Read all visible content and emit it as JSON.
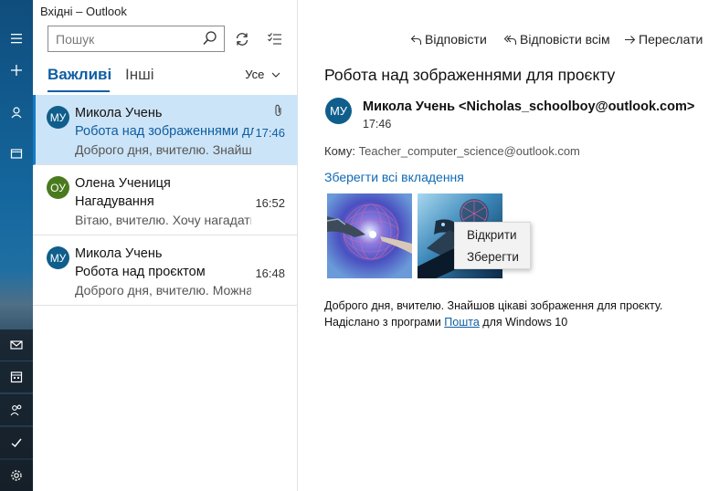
{
  "window": {
    "title": "Вхідні – Outlook"
  },
  "search": {
    "placeholder": "Пошук"
  },
  "tabs": [
    {
      "label": "Важливі"
    },
    {
      "label": "Інші"
    }
  ],
  "filter": {
    "label": "Усе"
  },
  "messages": [
    {
      "initials": "МУ",
      "avatar_color": "#0f5e8c",
      "sender": "Микола Учень",
      "subject": "Робота над зображеннями для проєкту",
      "preview": "Доброго дня, вчителю. Знайшов цікаві",
      "time": "17:46",
      "selected": true,
      "has_attachment": true
    },
    {
      "initials": "ОУ",
      "avatar_color": "#4a7a1e",
      "sender": "Олена Учениця",
      "subject": "Нагадування",
      "preview": "Вітаю, вчителю. Хочу нагадати",
      "time": "16:52",
      "selected": false
    },
    {
      "initials": "МУ",
      "avatar_color": "#0f5e8c",
      "sender": "Микола Учень",
      "subject": "Робота над проєктом",
      "preview": "Доброго дня, вчителю. Можна",
      "time": "16:48",
      "selected": false
    }
  ],
  "actions": {
    "reply": "Відповісти",
    "reply_all": "Відповісти всім",
    "forward": "Переслати"
  },
  "reading": {
    "subject": "Робота над зображеннями для проєкту",
    "avatar_initials": "МУ",
    "from": "Микола Учень <Nicholas_schoolboy@outlook.com>",
    "time": "17:46",
    "to_label": "Кому:",
    "to_address": "Teacher_computer_science@outlook.com",
    "save_all": "Зберегти всі вкладення",
    "body_line1": "Доброго дня, вчителю. Знайшов цікаві зображення для проєкту.",
    "body_line2_prefix": "Надіслано з програми",
    "body_line2_link": "Пошта",
    "body_line2_suffix": "для Windows 10"
  },
  "context_menu": {
    "open": "Відкрити",
    "save": "Зберегти"
  },
  "colors": {
    "accent": "#0f5ea3",
    "selected_bg": "#cce4f7"
  }
}
